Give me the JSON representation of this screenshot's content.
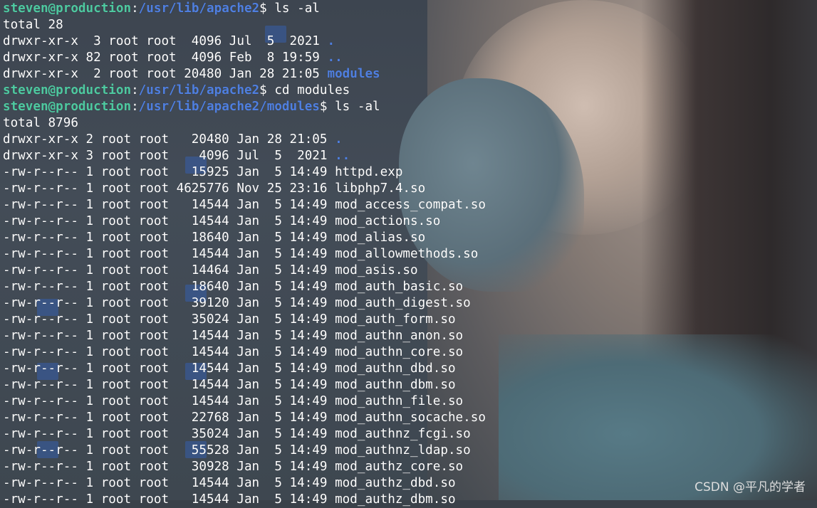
{
  "terminal": {
    "lines": [
      {
        "type": "prompt",
        "user": "steven@production",
        "sep": ":",
        "path": "/usr/lib/apache2",
        "sym": "$ ",
        "cmd": "ls -al"
      },
      {
        "type": "text",
        "text": "total 28"
      },
      {
        "type": "entry",
        "prefix": "drwxr-xr-x  3 root root  4096 Jul  5  2021 ",
        "name": ".",
        "is_dir": true
      },
      {
        "type": "entry",
        "prefix": "drwxr-xr-x 82 root root  4096 Feb  8 19:59 ",
        "name": "..",
        "is_dir": true
      },
      {
        "type": "entry",
        "prefix": "drwxr-xr-x  2 root root 20480 Jan 28 21:05 ",
        "name": "modules",
        "is_dir": true
      },
      {
        "type": "prompt",
        "user": "steven@production",
        "sep": ":",
        "path": "/usr/lib/apache2",
        "sym": "$ ",
        "cmd": "cd modules"
      },
      {
        "type": "prompt",
        "user": "steven@production",
        "sep": ":",
        "path": "/usr/lib/apache2/modules",
        "sym": "$ ",
        "cmd": "ls -al"
      },
      {
        "type": "text",
        "text": "total 8796"
      },
      {
        "type": "entry",
        "prefix": "drwxr-xr-x 2 root root   20480 Jan 28 21:05 ",
        "name": ".",
        "is_dir": true
      },
      {
        "type": "entry",
        "prefix": "drwxr-xr-x 3 root root    4096 Jul  5  2021 ",
        "name": "..",
        "is_dir": true
      },
      {
        "type": "entry",
        "prefix": "-rw-r--r-- 1 root root   15925 Jan  5 14:49 ",
        "name": "httpd.exp",
        "is_dir": false
      },
      {
        "type": "entry",
        "prefix": "-rw-r--r-- 1 root root 4625776 Nov 25 23:16 ",
        "name": "libphp7.4.so",
        "is_dir": false
      },
      {
        "type": "entry",
        "prefix": "-rw-r--r-- 1 root root   14544 Jan  5 14:49 ",
        "name": "mod_access_compat.so",
        "is_dir": false
      },
      {
        "type": "entry",
        "prefix": "-rw-r--r-- 1 root root   14544 Jan  5 14:49 ",
        "name": "mod_actions.so",
        "is_dir": false
      },
      {
        "type": "entry",
        "prefix": "-rw-r--r-- 1 root root   18640 Jan  5 14:49 ",
        "name": "mod_alias.so",
        "is_dir": false
      },
      {
        "type": "entry",
        "prefix": "-rw-r--r-- 1 root root   14544 Jan  5 14:49 ",
        "name": "mod_allowmethods.so",
        "is_dir": false
      },
      {
        "type": "entry",
        "prefix": "-rw-r--r-- 1 root root   14464 Jan  5 14:49 ",
        "name": "mod_asis.so",
        "is_dir": false
      },
      {
        "type": "entry",
        "prefix": "-rw-r--r-- 1 root root   18640 Jan  5 14:49 ",
        "name": "mod_auth_basic.so",
        "is_dir": false
      },
      {
        "type": "entry",
        "prefix": "-rw-r--r-- 1 root root   39120 Jan  5 14:49 ",
        "name": "mod_auth_digest.so",
        "is_dir": false
      },
      {
        "type": "entry",
        "prefix": "-rw-r--r-- 1 root root   35024 Jan  5 14:49 ",
        "name": "mod_auth_form.so",
        "is_dir": false
      },
      {
        "type": "entry",
        "prefix": "-rw-r--r-- 1 root root   14544 Jan  5 14:49 ",
        "name": "mod_authn_anon.so",
        "is_dir": false
      },
      {
        "type": "entry",
        "prefix": "-rw-r--r-- 1 root root   14544 Jan  5 14:49 ",
        "name": "mod_authn_core.so",
        "is_dir": false
      },
      {
        "type": "entry",
        "prefix": "-rw-r--r-- 1 root root   14544 Jan  5 14:49 ",
        "name": "mod_authn_dbd.so",
        "is_dir": false
      },
      {
        "type": "entry",
        "prefix": "-rw-r--r-- 1 root root   14544 Jan  5 14:49 ",
        "name": "mod_authn_dbm.so",
        "is_dir": false
      },
      {
        "type": "entry",
        "prefix": "-rw-r--r-- 1 root root   14544 Jan  5 14:49 ",
        "name": "mod_authn_file.so",
        "is_dir": false
      },
      {
        "type": "entry",
        "prefix": "-rw-r--r-- 1 root root   22768 Jan  5 14:49 ",
        "name": "mod_authn_socache.so",
        "is_dir": false
      },
      {
        "type": "entry",
        "prefix": "-rw-r--r-- 1 root root   35024 Jan  5 14:49 ",
        "name": "mod_authnz_fcgi.so",
        "is_dir": false
      },
      {
        "type": "entry",
        "prefix": "-rw-r--r-- 1 root root   55528 Jan  5 14:49 ",
        "name": "mod_authnz_ldap.so",
        "is_dir": false
      },
      {
        "type": "entry",
        "prefix": "-rw-r--r-- 1 root root   30928 Jan  5 14:49 ",
        "name": "mod_authz_core.so",
        "is_dir": false
      },
      {
        "type": "entry",
        "prefix": "-rw-r--r-- 1 root root   14544 Jan  5 14:49 ",
        "name": "mod_authz_dbd.so",
        "is_dir": false
      },
      {
        "type": "entry",
        "prefix": "-rw-r--r-- 1 root root   14544 Jan  5 14:49 ",
        "name": "mod_authz_dbm.so",
        "is_dir": false
      }
    ]
  },
  "watermark": "CSDN @平凡的学者",
  "colors": {
    "prompt_user": "#4ec9a0",
    "prompt_path": "#4f7fe0",
    "directory": "#4f7fe0",
    "text": "#ffffff"
  }
}
